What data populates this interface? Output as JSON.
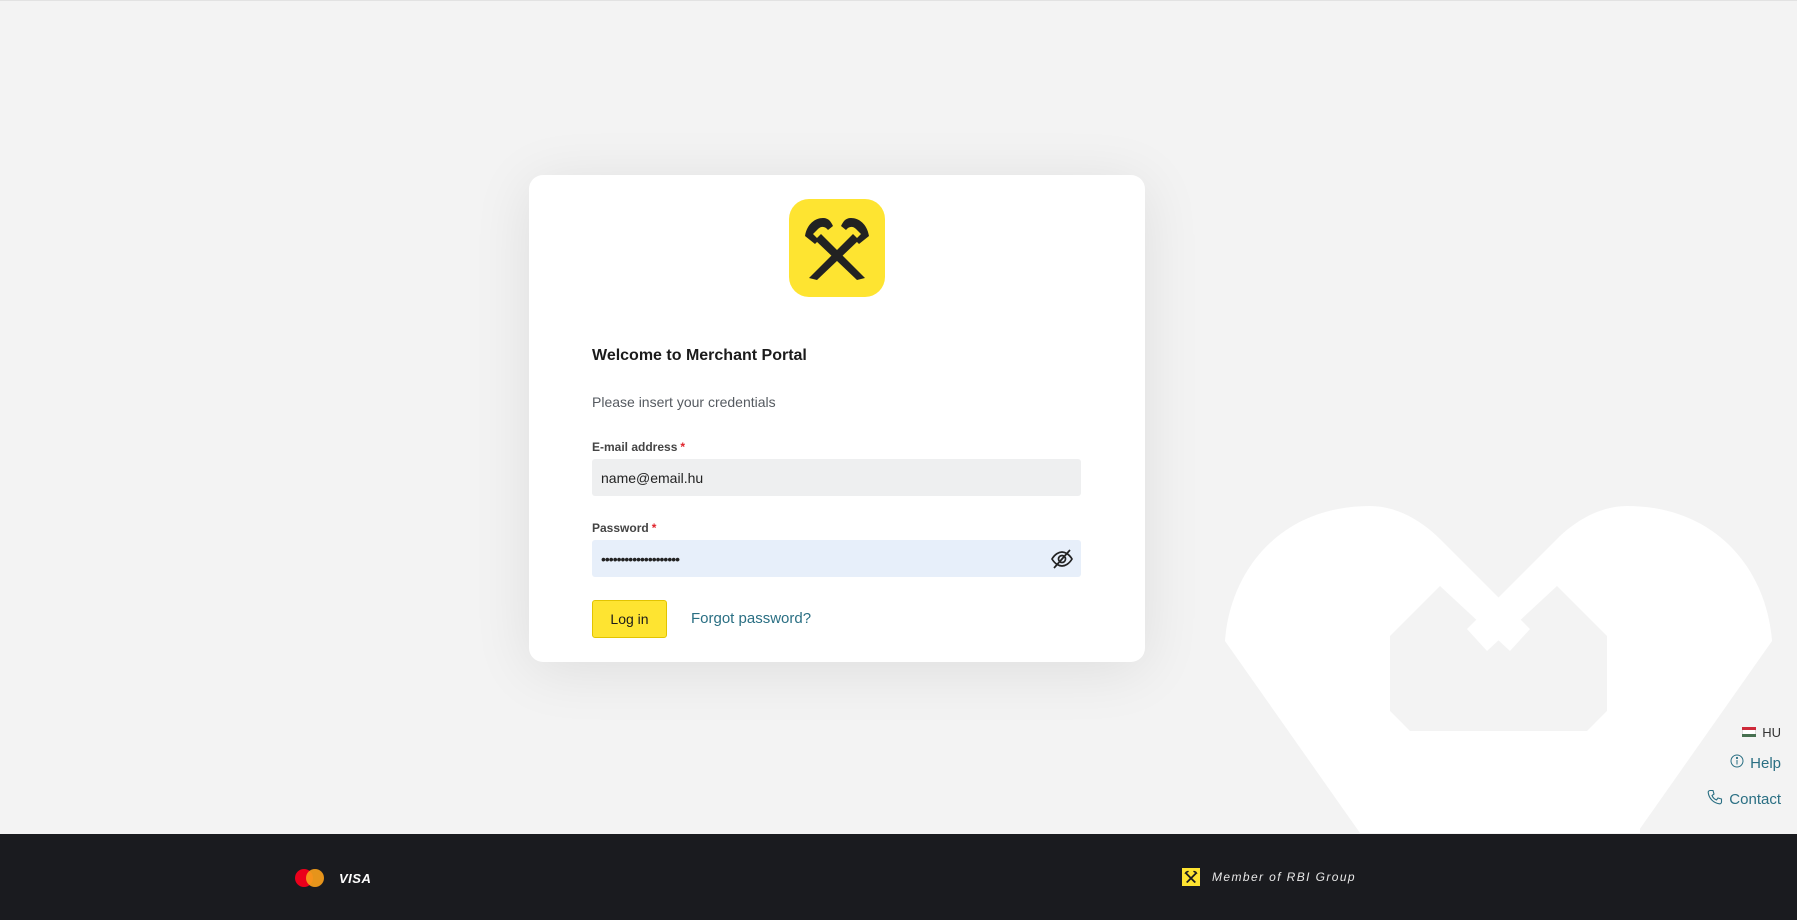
{
  "colors": {
    "brand_yellow": "#fee431",
    "link_teal": "#2a6f83",
    "footer_dark": "#1a1b1f",
    "page_bg": "#f3f3f3",
    "required_red": "#e0242c"
  },
  "login": {
    "title": "Welcome to Merchant Portal",
    "subtitle": "Please insert your credentials",
    "email_label": "E-mail address",
    "email_value": "name@email.hu",
    "password_label": "Password",
    "password_value": "••••••••••••••••••••",
    "required_marker": "*",
    "login_button": "Log in",
    "forgot_link": "Forgot password?"
  },
  "side_links": {
    "language": "HU",
    "help": "Help",
    "contact": "Contact"
  },
  "footer": {
    "visa": "VISA",
    "rbi_member": "Member of RBI Group"
  },
  "icons": {
    "brand_logo": "raiffeisen-gable-cross-icon",
    "password_toggle": "eye-slash-icon",
    "help": "info-circle-icon",
    "contact": "phone-icon",
    "language": "hungary-flag-icon",
    "card1": "mastercard-icon"
  }
}
